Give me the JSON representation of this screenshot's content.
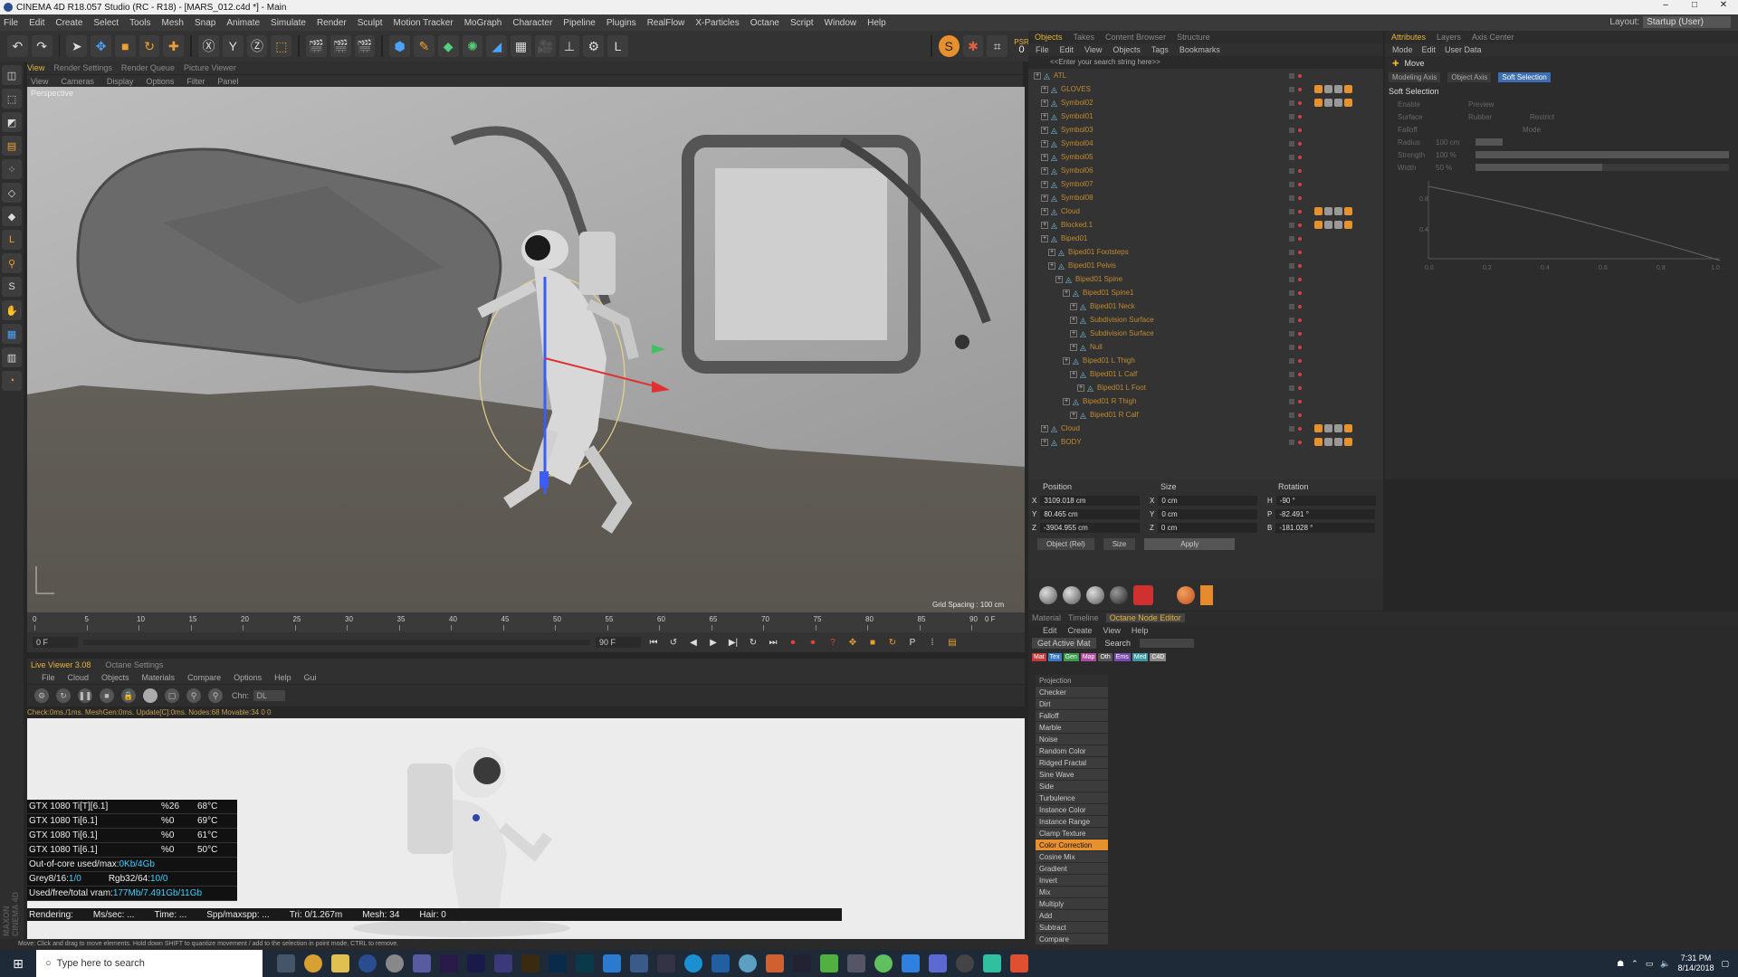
{
  "window": {
    "title": "CINEMA 4D R18.057 Studio (RC - R18) - [MARS_012.c4d *] - Main",
    "controls": [
      "–",
      "□",
      "✕"
    ]
  },
  "menu": {
    "items": [
      "File",
      "Edit",
      "Create",
      "Select",
      "Tools",
      "Mesh",
      "Snap",
      "Animate",
      "Simulate",
      "Render",
      "Sculpt",
      "Motion Tracker",
      "MoGraph",
      "Character",
      "Pipeline",
      "Plugins",
      "RealFlow",
      "X-Particles",
      "Octane",
      "Script",
      "Window",
      "Help"
    ],
    "layout_label": "Layout:",
    "layout_value": "Startup (User)"
  },
  "toolbar": {
    "psr_label": "PSR",
    "psr_value": "0"
  },
  "viewport": {
    "tabs": [
      "View",
      "Render Settings",
      "Render Queue",
      "Picture Viewer"
    ],
    "menu": [
      "View",
      "Cameras",
      "Display",
      "Options",
      "Filter",
      "Panel"
    ],
    "camera_label": "Perspective",
    "grid_spacing": "Grid Spacing : 100 cm"
  },
  "timeline": {
    "ticks": [
      "0",
      "5",
      "10",
      "15",
      "20",
      "25",
      "30",
      "35",
      "40",
      "45",
      "50",
      "55",
      "60",
      "65",
      "70",
      "75",
      "80",
      "85",
      "90"
    ],
    "end_frame": "0 F",
    "start_field": "0 F",
    "end_field": "90 F"
  },
  "live_viewer": {
    "tabs": [
      "Live Viewer 3.08",
      "Octane Settings"
    ],
    "menu": [
      "File",
      "Cloud",
      "Objects",
      "Materials",
      "Compare",
      "Options",
      "Help",
      "Gui"
    ],
    "channel_label": "Chn:",
    "channel_value": "DL",
    "status": "Check:0ms./1ms. MeshGen:0ms. Update[C]:0ms. Nodes:68 Movable:34  0 0",
    "gpus": [
      {
        "name": "GTX 1080 Ti[T][6.1]",
        "usage": "%26",
        "temp": "68°C"
      },
      {
        "name": "GTX 1080 Ti[6.1]",
        "usage": "%0",
        "temp": "69°C"
      },
      {
        "name": "GTX 1080 Ti[6.1]",
        "usage": "%0",
        "temp": "61°C"
      },
      {
        "name": "GTX 1080 Ti[6.1]",
        "usage": "%0",
        "temp": "50°C"
      }
    ],
    "out_of_core_label": "Out-of-core used/max:",
    "out_of_core_value": "0Kb/4Gb",
    "grey_label": "Grey8/16: ",
    "grey_value": "1/0",
    "rgb_label": "Rgb32/64: ",
    "rgb_value": "10/0",
    "vram_label": "Used/free/total vram: ",
    "vram_value": "177Mb/7.491Gb/11Gb",
    "rendering": {
      "label": "Rendering:",
      "ms": "Ms/sec: ...",
      "time": "Time: ...",
      "spp": "Spp/maxspp: ...",
      "tri": "Tri: 0/1.267m",
      "mesh": "Mesh: 34",
      "hair": "Hair: 0"
    }
  },
  "status_bar": "Move: Click and drag to move elements. Hold down SHIFT to quantize movement / add to the selection in point mode, CTRL to remove.",
  "objects_panel": {
    "tabs": [
      "Objects",
      "Takes",
      "Content Browser",
      "Structure"
    ],
    "menu": [
      "File",
      "Edit",
      "View",
      "Objects",
      "Tags",
      "Bookmarks"
    ],
    "search_placeholder": "<<Enter your search string here>>",
    "tree": [
      {
        "label": "ATL",
        "depth": 0
      },
      {
        "label": "GLOVES",
        "depth": 1
      },
      {
        "label": "Symbol02",
        "depth": 1
      },
      {
        "label": "Symbol01",
        "depth": 1
      },
      {
        "label": "Symbol03",
        "depth": 1
      },
      {
        "label": "Symbol04",
        "depth": 1
      },
      {
        "label": "Symbol05",
        "depth": 1
      },
      {
        "label": "Symbol06",
        "depth": 1
      },
      {
        "label": "Symbol07",
        "depth": 1
      },
      {
        "label": "Symbol08",
        "depth": 1
      },
      {
        "label": "Cloud",
        "depth": 1
      },
      {
        "label": "Blocked.1",
        "depth": 1
      },
      {
        "label": "Biped01",
        "depth": 1
      },
      {
        "label": "Biped01 Footsteps",
        "depth": 2
      },
      {
        "label": "Biped01 Pelvis",
        "depth": 2
      },
      {
        "label": "Biped01 Spine",
        "depth": 3
      },
      {
        "label": "Biped01 Spine1",
        "depth": 4
      },
      {
        "label": "Biped01 Neck",
        "depth": 5
      },
      {
        "label": "Subdivision Surface",
        "depth": 5
      },
      {
        "label": "Subdivision Surface",
        "depth": 5
      },
      {
        "label": "Null",
        "depth": 5
      },
      {
        "label": "Biped01 L Thigh",
        "depth": 4
      },
      {
        "label": "Biped01 L Calf",
        "depth": 5
      },
      {
        "label": "Biped01 L Foot",
        "depth": 6
      },
      {
        "label": "Biped01 R Thigh",
        "depth": 4
      },
      {
        "label": "Biped01 R Calf",
        "depth": 5
      },
      {
        "label": "Cloud",
        "depth": 1
      },
      {
        "label": "BODY",
        "depth": 1
      }
    ]
  },
  "coordinates": {
    "headers": [
      "Position",
      "Size",
      "Rotation"
    ],
    "rows": [
      {
        "axis": "X",
        "pos": "3109.018 cm",
        "saxis": "X",
        "size": "0 cm",
        "raxis": "H",
        "rot": "-90 °"
      },
      {
        "axis": "Y",
        "pos": "80.465 cm",
        "saxis": "Y",
        "size": "0 cm",
        "raxis": "P",
        "rot": "-82.491 °"
      },
      {
        "axis": "Z",
        "pos": "-3904.955 cm",
        "saxis": "Z",
        "size": "0 cm",
        "raxis": "B",
        "rot": "-181.028 °"
      }
    ],
    "mode": "Object (Rel)",
    "size_mode": "Size",
    "apply": "Apply"
  },
  "attributes": {
    "tabs": [
      "Attributes",
      "Layers",
      "Axis Center"
    ],
    "menu": [
      "Mode",
      "Edit",
      "User Data"
    ],
    "tool": "Move",
    "subtabs": [
      "Modeling Axis",
      "Object Axis",
      "Soft Selection"
    ],
    "section": "Soft Selection",
    "props": [
      "Enable",
      "Preview",
      "Surface",
      "Rubber",
      "Restrict",
      "Falloff",
      "Mode",
      "Radius",
      "Strength",
      "Width"
    ],
    "values": {
      "radius": "100 cm",
      "strength": "100 %",
      "width": "50 %"
    },
    "curve_ticks": [
      "0.0",
      "0.2",
      "0.4",
      "0.6",
      "0.8",
      "1.0"
    ],
    "curve_y": [
      "0.8",
      "0.4"
    ]
  },
  "node_editor": {
    "tabs": [
      "Material",
      "Timeline",
      "Octane Node Editor"
    ],
    "menu": [
      "Edit",
      "Create",
      "View",
      "Help"
    ],
    "get_active_mat": "Get Active Mat",
    "search": "Search",
    "categories": [
      {
        "label": "Mat",
        "color": "#c23b3b"
      },
      {
        "label": "Tex",
        "color": "#3a7bbf"
      },
      {
        "label": "Gen",
        "color": "#3a9a4a"
      },
      {
        "label": "Map",
        "color": "#b04aa0"
      },
      {
        "label": "Oth",
        "color": "#555555"
      },
      {
        "label": "Ems",
        "color": "#7a4ab0"
      },
      {
        "label": "Med",
        "color": "#3a9aa0"
      },
      {
        "label": "C4D",
        "color": "#888888"
      }
    ],
    "nodes": [
      "Projection",
      "Checker",
      "Dirt",
      "Falloff",
      "Marble",
      "Noise",
      "Random Color",
      "Ridged Fractal",
      "Sine Wave",
      "Side",
      "Turbulence",
      "Instance Color",
      "Instance Range",
      "Clamp Texture",
      "Color Correction",
      "Cosine Mix",
      "Gradient",
      "Invert",
      "Mix",
      "Multiply",
      "Add",
      "Subtract",
      "Compare"
    ],
    "highlight": "Color Correction"
  },
  "taskbar": {
    "search_placeholder": "Type here to search",
    "time": "7:31 PM",
    "date": "8/14/2018"
  },
  "brand": "MAXON CINEMA 4D"
}
